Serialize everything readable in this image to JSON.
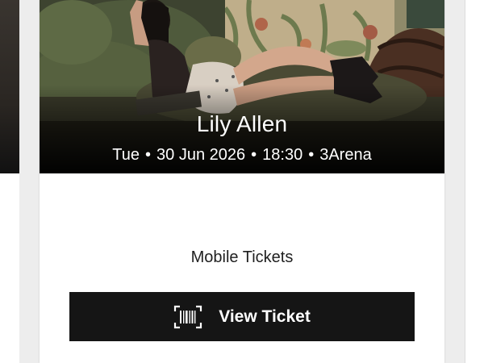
{
  "event": {
    "artist": "Lily Allen",
    "day": "Tue",
    "date": "30 Jun 2026",
    "time": "18:30",
    "venue": "3Arena",
    "separator": "•"
  },
  "tickets": {
    "type_label": "Mobile Tickets",
    "view_button_label": "View Ticket",
    "view_button_icon": "barcode-icon"
  },
  "colors": {
    "button_bg": "#151515",
    "button_text": "#ffffff",
    "card_bg": "#ffffff"
  }
}
